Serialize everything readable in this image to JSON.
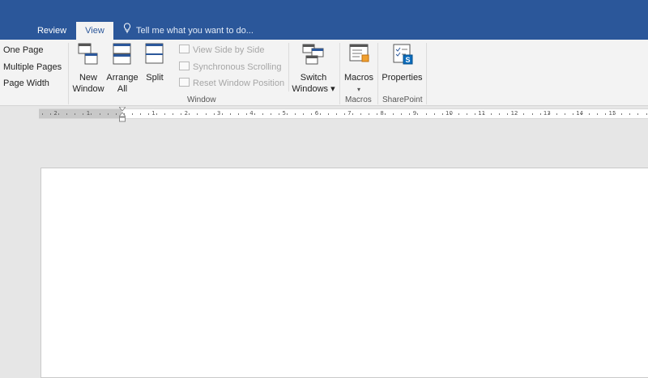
{
  "tabs": {
    "review": "Review",
    "view": "View"
  },
  "tellme": {
    "text": "Tell me what you want to do..."
  },
  "zoom_group": {
    "one_page": "One Page",
    "multiple_pages": "Multiple Pages",
    "page_width": "Page Width"
  },
  "window_group": {
    "new_window": [
      "New",
      "Window"
    ],
    "arrange_all": [
      "Arrange",
      "All"
    ],
    "split": "Split",
    "view_side_by_side": "View Side by Side",
    "synchronous_scrolling": "Synchronous Scrolling",
    "reset_window_position": "Reset Window Position",
    "switch_windows": [
      "Switch",
      "Windows ▾"
    ],
    "label": "Window"
  },
  "macros_group": {
    "macros": "Macros",
    "dropdown": "▾",
    "label": "Macros"
  },
  "sharepoint_group": {
    "properties": "Properties",
    "label": "SharePoint"
  },
  "ruler": {
    "left_ticks": [
      "2",
      "1"
    ],
    "right_ticks": [
      "1",
      "2",
      "3",
      "4",
      "5",
      "6",
      "7",
      "8",
      "9",
      "10",
      "11",
      "12",
      "13",
      "14",
      "15"
    ]
  },
  "colors": {
    "accent": "#2b579a",
    "ribbon": "#f3f3f3",
    "workspace": "#e6e6e6"
  }
}
